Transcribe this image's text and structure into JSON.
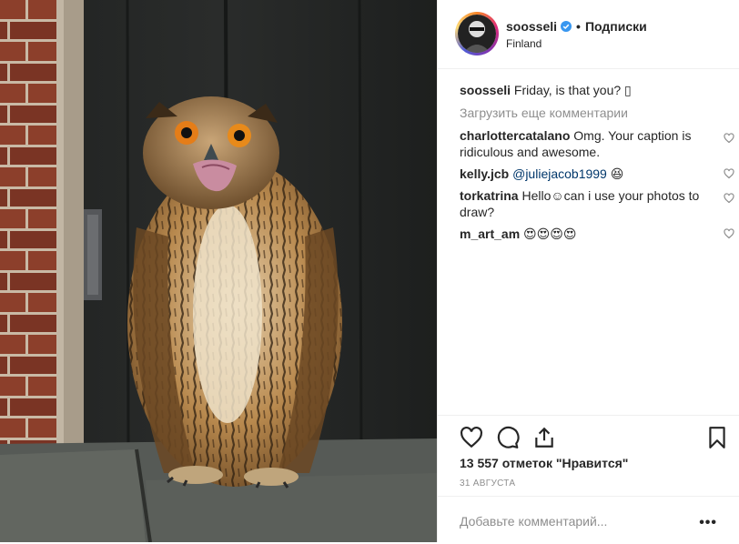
{
  "header": {
    "username": "soosseli",
    "separator": "•",
    "follow_label": "Подписки",
    "location": "Finland"
  },
  "caption": {
    "username": "soosseli",
    "text": "Friday, is that you? ▯"
  },
  "load_more_label": "Загрузить еще комментарии",
  "comments": [
    {
      "username": "charlottercatalano",
      "text": "Omg. Your caption is ridiculous and awesome."
    },
    {
      "username": "kelly.jcb",
      "mention": "@juliejacob1999",
      "text": "😆"
    },
    {
      "username": "torkatrina",
      "text": "Hello☺can i use your photos to draw?"
    },
    {
      "username": "m_art_am",
      "text": "😍😍😍😍"
    }
  ],
  "likes_text": "13 557 отметок \"Нравится\"",
  "date": "31 АВГУСТА",
  "add_comment_placeholder": "Добавьте комментарий...",
  "more_label": "•••",
  "icons": {
    "like": "heart-icon",
    "comment": "comment-bubble-icon",
    "share": "share-icon",
    "save": "bookmark-icon",
    "verified": "verified-badge-icon"
  },
  "colors": {
    "verified": "#3897f0",
    "link": "#00376b",
    "muted": "#8e8e8e"
  }
}
